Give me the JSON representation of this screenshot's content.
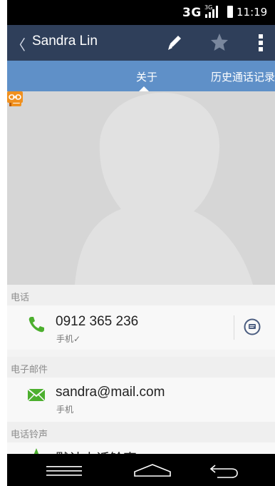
{
  "status_bar": {
    "network": "3G",
    "time": "11:19"
  },
  "action_bar": {
    "back_glyph": "〈",
    "title": "Sandra Lin",
    "edit_icon": "pencil-icon",
    "favorite_icon": "star-icon",
    "more_icon": "overflow-menu-icon"
  },
  "tabs": [
    {
      "label": "关于",
      "selected": true
    },
    {
      "label": "历史通话记录",
      "selected": false
    }
  ],
  "photo": {
    "placeholder_icon": "person-silhouette-icon",
    "badges": [
      "contact-card-icon",
      "link-icon"
    ]
  },
  "sections": {
    "phone": {
      "header": "电话",
      "number": "0912 365 236",
      "type": "手机✓",
      "icon": "phone-icon",
      "action_icon": "message-icon"
    },
    "email": {
      "header": "电子邮件",
      "address": "sandra@mail.com",
      "type": "手机",
      "icon": "email-icon"
    },
    "ringtone": {
      "header": "电话铃声",
      "value": "默认电话铃声",
      "icon": "ringtone-icon"
    }
  },
  "nav_bar": {
    "icons": [
      "recent-apps-icon",
      "home-icon",
      "back-icon"
    ]
  },
  "colors": {
    "action_bar": "#2f3f5a",
    "tab_bar": "#5f90c8",
    "phone_green": "#4caf2e",
    "badge_orange": "#f0901e"
  }
}
